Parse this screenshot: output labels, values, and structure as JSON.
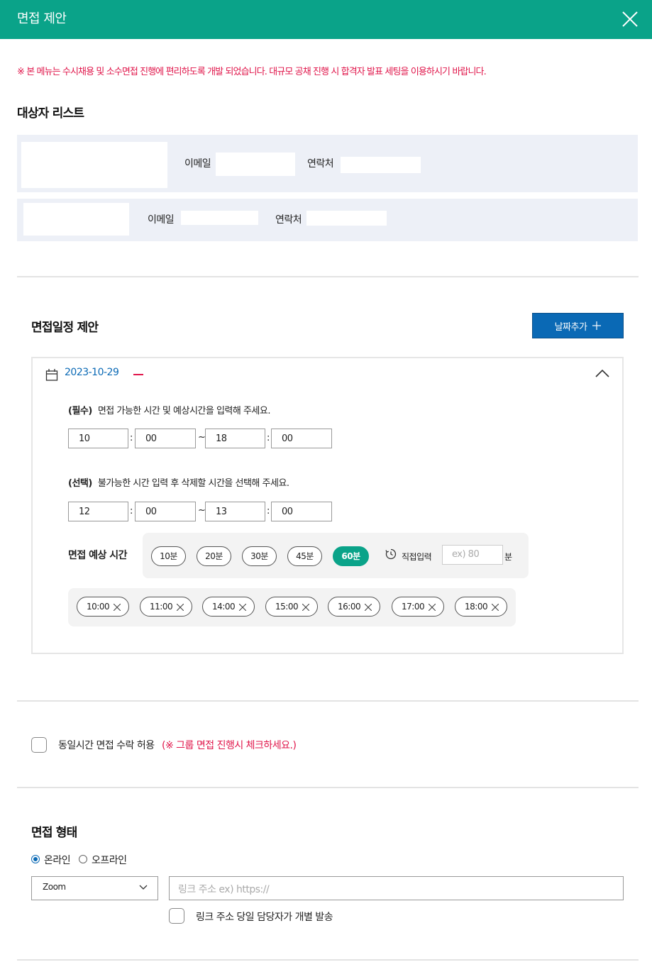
{
  "header": {
    "title": "면접 제안",
    "close_icon": "close-icon"
  },
  "notice": "※ 본 메뉴는 수시채용 및 소수면접 진행에 편리하도록 개발 되었습니다. 대규모 공채 진행 시 합격자 발표 세팅을 이용하시기 바랍니다.",
  "candidates": {
    "title": "대상자 리스트",
    "rows": [
      {
        "email_label": "이메일",
        "phone_label": "연락처"
      },
      {
        "email_label": "이메일",
        "phone_label": "연락처"
      }
    ]
  },
  "schedule": {
    "title": "면접일정 제안",
    "add_button": "날짜추가",
    "add_icon": "plus-icon",
    "date": "2023-10-29",
    "required": {
      "tag": "(필수)",
      "text": "면접 가능한 시간 및 예상시간을 입력해 주세요.",
      "start_hour": "10",
      "start_min": "00",
      "end_hour": "18",
      "end_min": "00"
    },
    "optional": {
      "tag": "(선택)",
      "text": "불가능한 시간 입력 후 삭제할 시간을 선택해 주세요.",
      "start_hour": "12",
      "start_min": "00",
      "end_hour": "13",
      "end_min": "00"
    },
    "colon": ":",
    "tilde": "~",
    "duration": {
      "label": "면접 예상 시간",
      "options": [
        "10분",
        "20분",
        "30분",
        "45분",
        "60분"
      ],
      "selected": "60분",
      "direct_label": "직접입력",
      "direct_placeholder": "ex) 80",
      "unit": "분"
    },
    "slots": [
      "10:00",
      "11:00",
      "14:00",
      "15:00",
      "16:00",
      "17:00",
      "18:00"
    ]
  },
  "same_time": {
    "label": "동일시간 면접 수락 허용",
    "note": "(※ 그룹 면접 진행시 체크하세요.)"
  },
  "format": {
    "title": "면접 형태",
    "online": "온라인",
    "offline": "오프라인",
    "selected": "온라인",
    "platform": "Zoom",
    "link_placeholder": "링크 주소 ex) https://",
    "individual_label": "링크 주소 당일 담당자가 개별 발송"
  },
  "colors": {
    "header": "#0aa389",
    "accent_blue": "#0a69b5",
    "notice_red": "#e0154a",
    "candidate_bg": "#edf0f7"
  }
}
